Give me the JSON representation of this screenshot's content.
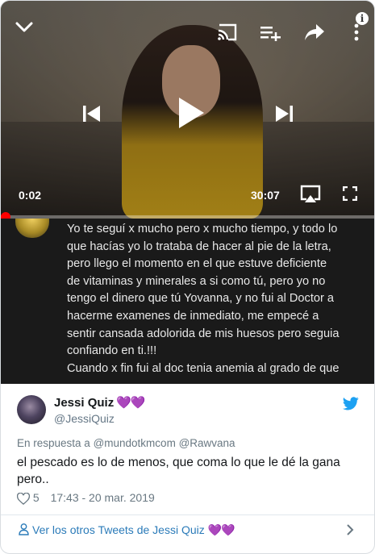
{
  "player": {
    "current_time": "0:02",
    "duration": "30:07",
    "progress_fraction": 0.001,
    "info_symbol": "i",
    "icons": [
      "chevron-down-icon",
      "cast-icon",
      "add-to-queue-icon",
      "share-icon",
      "more-vert-icon",
      "info-icon",
      "previous-icon",
      "play-icon",
      "next-icon",
      "airplay-icon",
      "fullscreen-icon"
    ]
  },
  "embedded_text": {
    "lines": [
      "Yo te seguí x mucho pero x mucho tiempo, y todo lo",
      "que hacías yo lo trataba de hacer al pie de la letra,",
      "pero llego el momento en el que estuve deficiente",
      "de vitaminas y minerales a si como tú,  pero yo no",
      "tengo el dinero que tú Yovanna, y no fui al Doctor a",
      "hacerme examenes de inmediato, me empecé a",
      "sentir cansada adolorida de mis huesos pero seguia",
      "confiando en ti.!!!",
      "Cuando x fin fui al doc tenia anemia al grado de que"
    ]
  },
  "tweet": {
    "author_name": "Jessi Quiz",
    "author_emoji": "💜💜",
    "author_handle": "@JessiQuiz",
    "reply_prefix": "En respuesta a",
    "reply_to_1": "@mundotkmcom",
    "reply_to_2": "@Rawvana",
    "text": "el pescado es lo de menos, que coma lo que le dé la gana pero..",
    "like_count": "5",
    "timestamp": "17:43 - 20 mar. 2019",
    "more_link": "Ver los otros Tweets de Jessi Quiz",
    "more_link_emoji": "💜💜"
  },
  "colors": {
    "progress": "#ff0000",
    "link": "#2b7bb9",
    "twitter_blue": "#1da1f2",
    "heart_emoji": "#a56cc1",
    "meta_text": "#697882"
  }
}
